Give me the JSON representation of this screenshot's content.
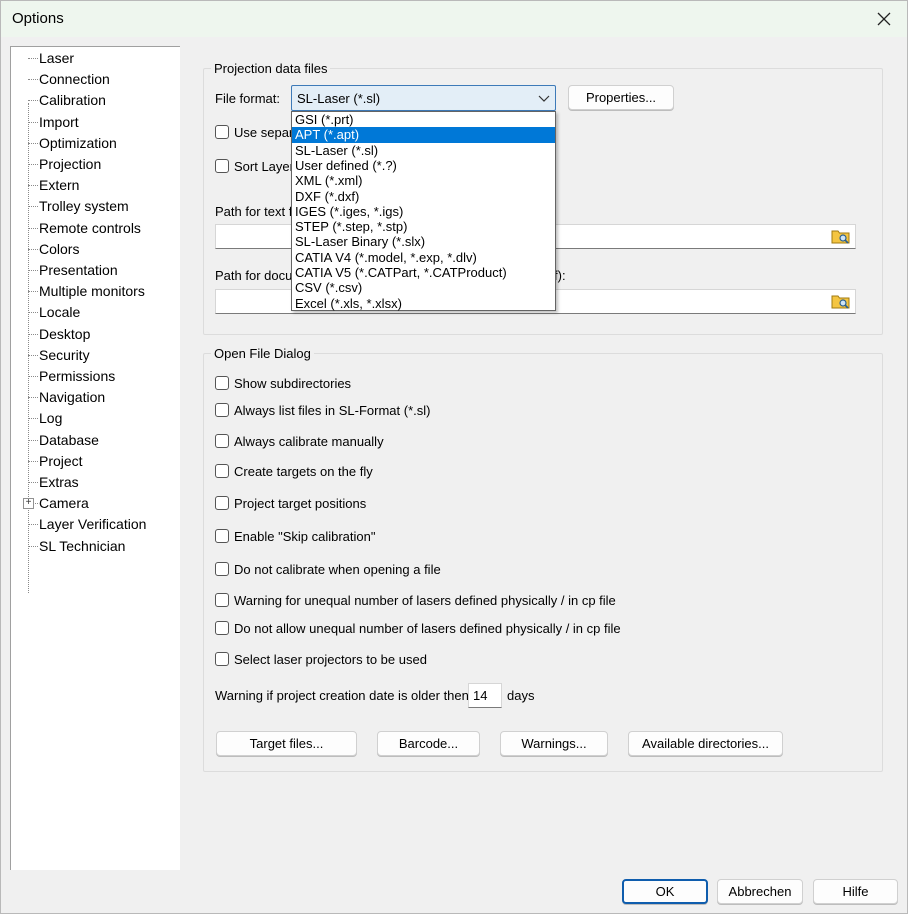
{
  "window": {
    "title": "Options"
  },
  "tree": {
    "items": [
      {
        "label": "Laser"
      },
      {
        "label": "Connection"
      },
      {
        "label": "Calibration"
      },
      {
        "label": "Import"
      },
      {
        "label": "Optimization"
      },
      {
        "label": "Projection"
      },
      {
        "label": "Extern"
      },
      {
        "label": "Trolley system"
      },
      {
        "label": "Remote controls"
      },
      {
        "label": "Colors"
      },
      {
        "label": "Presentation"
      },
      {
        "label": "Multiple monitors"
      },
      {
        "label": "Locale"
      },
      {
        "label": "Desktop"
      },
      {
        "label": "Security"
      },
      {
        "label": "Permissions"
      },
      {
        "label": "Navigation"
      },
      {
        "label": "Log"
      },
      {
        "label": "Database"
      },
      {
        "label": "Project"
      },
      {
        "label": "Extras"
      },
      {
        "label": "Camera",
        "expandable": true
      },
      {
        "label": "Layer Verification"
      },
      {
        "label": "SL Technician"
      }
    ]
  },
  "projection_group": {
    "title": "Projection data files",
    "file_format_label": "File format:",
    "file_format_value": "SL-Laser (*.sl)",
    "properties_button": "Properties...",
    "use_separate_label": "Use separa",
    "sort_layers_label": "Sort Layer",
    "path_text_label": "Path for text fi",
    "path_doc_label_start": "Path for docu",
    "path_doc_label_end": "f):",
    "path_text_value": "",
    "path_doc_value": ""
  },
  "dropdown": {
    "options": [
      "GSI (*.prt)",
      "APT (*.apt)",
      "SL-Laser (*.sl)",
      "User defined (*.?)",
      "XML (*.xml)",
      "DXF (*.dxf)",
      "IGES (*.iges, *.igs)",
      "STEP (*.step, *.stp)",
      "SL-Laser Binary (*.slx)",
      "CATIA V4 (*.model, *.exp, *.dlv)",
      "CATIA V5 (*.CATPart, *.CATProduct)",
      "CSV (*.csv)",
      "Excel (*.xls, *.xlsx)"
    ],
    "highlighted_index": 1
  },
  "open_file_group": {
    "title": "Open File  Dialog",
    "checkboxes": [
      "Show subdirectories",
      "Always list files in SL-Format (*.sl)",
      "Always calibrate manually",
      "Create targets on the fly",
      "Project target positions",
      "Enable \"Skip calibration\"",
      "Do not calibrate when opening a file",
      "Warning for unequal number of lasers defined physically / in cp file",
      "Do not allow unequal number of lasers defined physically / in cp file",
      "Select laser projectors to be used"
    ],
    "warning_label": "Warning if project creation date is older then",
    "warning_days_value": "14",
    "days_label": "days",
    "buttons": {
      "target_files": "Target files...",
      "barcode": "Barcode...",
      "warnings": "Warnings...",
      "available_directories": "Available directories..."
    }
  },
  "footer": {
    "ok": "OK",
    "cancel": "Abbrechen",
    "help": "Hilfe"
  },
  "colors": {
    "accent": "#0078d7",
    "default_button_border": "#0f5dad"
  }
}
